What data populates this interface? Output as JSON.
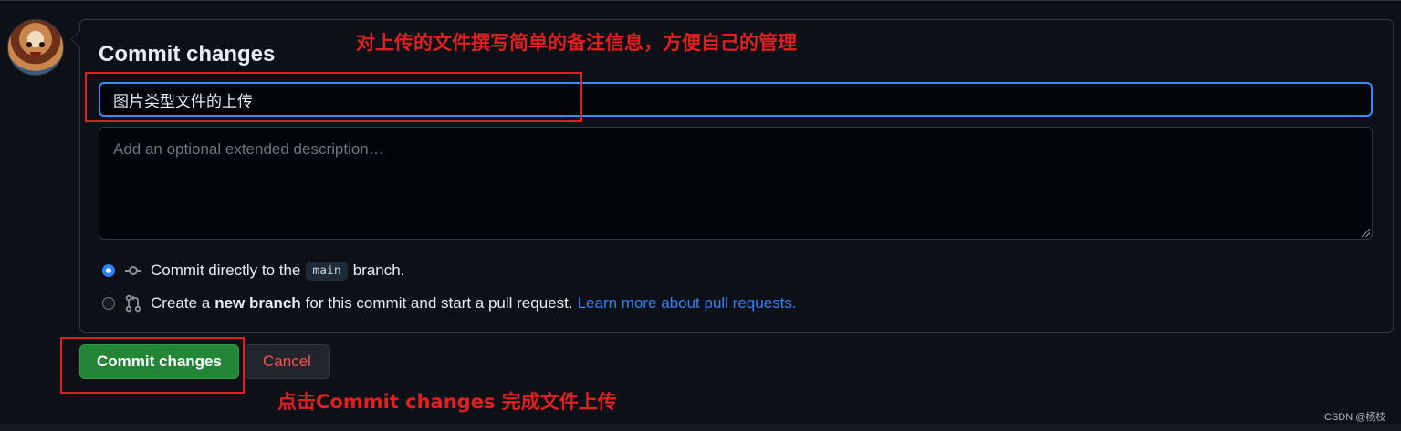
{
  "form": {
    "title": "Commit changes",
    "summary_value": "图片类型文件的上传",
    "description_placeholder": "Add an optional extended description…"
  },
  "options": {
    "direct": {
      "prefix": "Commit directly to the",
      "branch": "main",
      "suffix": "branch.",
      "selected": true
    },
    "new_branch": {
      "prefix": "Create a",
      "bold": "new branch",
      "suffix": "for this commit and start a pull request.",
      "link": "Learn more about pull requests.",
      "selected": false
    }
  },
  "buttons": {
    "commit": "Commit changes",
    "cancel": "Cancel"
  },
  "annotations": {
    "top": "对上传的文件撰写简单的备注信息，方便自己的管理",
    "bottom": "点击Commit changes 完成文件上传"
  },
  "watermark": "CSDN @杨枝",
  "colors": {
    "background": "#0d1117",
    "accent": "#2f81f7",
    "commit_button": "#238636",
    "cancel_text": "#f85149",
    "annotation": "#e02020"
  },
  "icons": {
    "commit": "git-commit-icon",
    "pull_request": "git-pull-request-icon"
  }
}
